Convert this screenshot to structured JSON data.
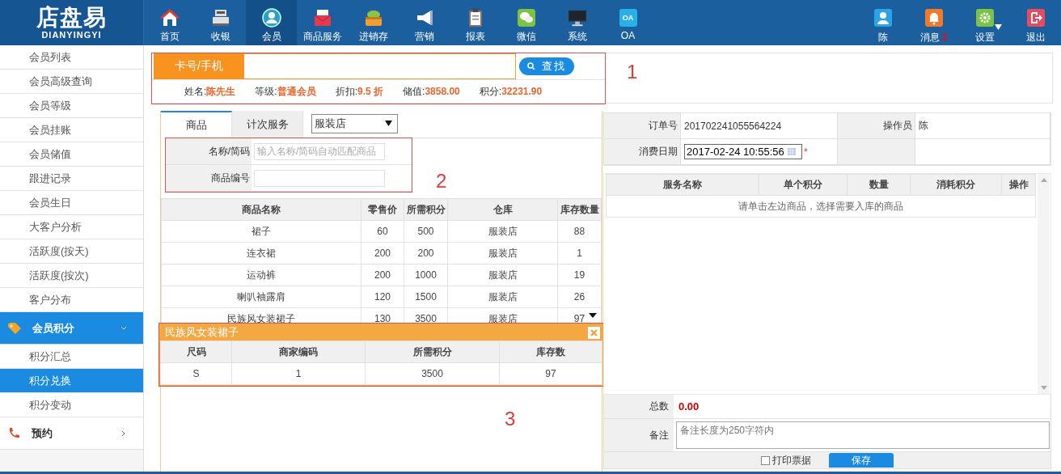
{
  "header": {
    "logo": {
      "title": "店盘易",
      "subtitle": "DIANYINGYI"
    },
    "nav": [
      {
        "label": "首页",
        "selected": false
      },
      {
        "label": "收银",
        "selected": false
      },
      {
        "label": "会员",
        "selected": true
      },
      {
        "label": "商品服务",
        "selected": false
      },
      {
        "label": "进销存",
        "selected": false
      },
      {
        "label": "营销",
        "selected": false
      },
      {
        "label": "报表",
        "selected": false
      },
      {
        "label": "微信",
        "selected": false
      },
      {
        "label": "系统",
        "selected": false
      },
      {
        "label": "OA",
        "selected": false,
        "badge": "OA"
      }
    ],
    "user_menu": [
      {
        "label": "陈",
        "dropdown": false
      },
      {
        "label": "消息",
        "count": "2",
        "dropdown": false
      },
      {
        "label": "设置",
        "dropdown": true
      },
      {
        "label": "退出",
        "dropdown": false
      }
    ]
  },
  "sidebar": {
    "items": [
      {
        "label": "会员列表",
        "selected": false
      },
      {
        "label": "会员高级查询",
        "selected": false
      },
      {
        "label": "会员等级",
        "selected": false
      },
      {
        "label": "会员挂账",
        "selected": false
      },
      {
        "label": "会员储值",
        "selected": false
      },
      {
        "label": "跟进记录",
        "selected": false
      },
      {
        "label": "会员生日",
        "selected": false
      },
      {
        "label": "大客户分析",
        "selected": false
      },
      {
        "label": "活跃度(按天)",
        "selected": false
      },
      {
        "label": "活跃度(按次)",
        "selected": false
      },
      {
        "label": "客户分布",
        "selected": false
      }
    ],
    "groups": [
      {
        "label": "会员积分",
        "expanded": true,
        "children": [
          {
            "label": "积分汇总",
            "selected": false
          },
          {
            "label": "积分兑换",
            "selected": true
          },
          {
            "label": "积分变动",
            "selected": false
          }
        ]
      },
      {
        "label": "预约",
        "expanded": false
      }
    ]
  },
  "member_search": {
    "label": "卡号/手机",
    "button": "查找",
    "info": [
      {
        "label": "姓名:",
        "value": "陈先生"
      },
      {
        "label": "等级:",
        "value": "普通会员"
      },
      {
        "label": "折扣:",
        "value": "9.5 折"
      },
      {
        "label": "储值:",
        "value": "3858.00"
      },
      {
        "label": "积分:",
        "value": "32231.90"
      }
    ]
  },
  "goods_panel": {
    "tabs": [
      {
        "label": "商品",
        "selected": true
      },
      {
        "label": "计次服务",
        "selected": false
      }
    ],
    "store_select": "服装店",
    "form": [
      {
        "label": "名称/简码",
        "placeholder": "输入名称/简码自动匹配商品"
      },
      {
        "label": "商品编号"
      }
    ],
    "table": {
      "columns": [
        "商品名称",
        "零售价",
        "所需积分",
        "仓库",
        "库存数量"
      ],
      "rows": [
        {
          "cells": [
            "裙子",
            "60",
            "500",
            "服装店",
            "88"
          ],
          "expanded": false
        },
        {
          "cells": [
            "连衣裙",
            "200",
            "200",
            "服装店",
            "1"
          ],
          "expanded": false
        },
        {
          "cells": [
            "运动裤",
            "200",
            "1000",
            "服装店",
            "19"
          ],
          "expanded": false
        },
        {
          "cells": [
            "喇叭袖露肩",
            "120",
            "1500",
            "服装店",
            "26"
          ],
          "expanded": false
        },
        {
          "cells": [
            "民族风女装裙子",
            "130",
            "3500",
            "服装店",
            "97"
          ],
          "expanded": true
        }
      ]
    },
    "popup": {
      "title": "民族风女装裙子",
      "columns": [
        "尺码",
        "商家编码",
        "所需积分",
        "库存数"
      ],
      "rows": [
        [
          "S",
          "1",
          "3500",
          "97"
        ]
      ]
    }
  },
  "order_panel": {
    "fields": [
      {
        "label": "订单号",
        "value": "201702241055564224"
      },
      {
        "label": "操作员",
        "value": "陈"
      }
    ],
    "date": {
      "label": "消费日期",
      "value": "2017-02-24 10:55:56",
      "required": "*"
    },
    "table": {
      "columns": [
        "服务名称",
        "单个积分",
        "数量",
        "消耗积分",
        "操作"
      ],
      "empty_message": "请单击左边商品，选择需要入库的商品"
    },
    "total": {
      "label": "总数",
      "value": "0.00"
    },
    "note": {
      "label": "备注",
      "placeholder": "备注长度为250字符内"
    },
    "print_receipt": {
      "label": "打印票据",
      "checked": false
    },
    "save_button": "保存"
  },
  "annotations": [
    "1",
    "2",
    "3"
  ]
}
